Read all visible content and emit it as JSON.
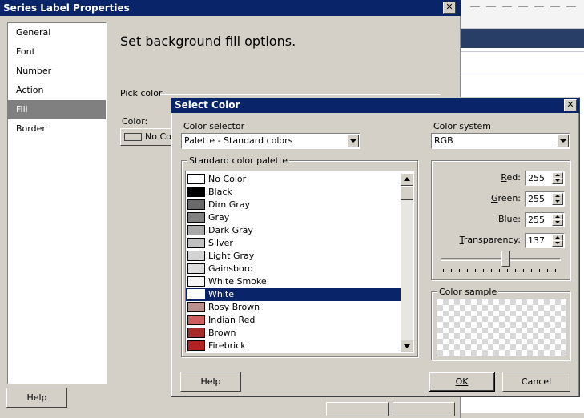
{
  "outer_window": {
    "title": "Series Label Properties",
    "close_glyph": "✕",
    "nav_items": [
      "General",
      "Font",
      "Number",
      "Action",
      "Fill",
      "Border"
    ],
    "nav_selected": "Fill",
    "heading": "Set background fill options.",
    "pick_color_label": "Pick color",
    "color_label": "Color:",
    "color_button_text": "No Co",
    "help_label": "Help"
  },
  "select_color_dialog": {
    "title": "Select Color",
    "close_glyph": "✕",
    "color_selector_label": "Color selector",
    "color_selector_value": "Palette - Standard colors",
    "color_system_label": "Color system",
    "color_system_value": "RGB",
    "palette_group_title": "Standard color palette",
    "palette_items": [
      {
        "name": "No Color",
        "color": "#ffffff"
      },
      {
        "name": "Black",
        "color": "#000000"
      },
      {
        "name": "Dim Gray",
        "color": "#696969"
      },
      {
        "name": "Gray",
        "color": "#808080"
      },
      {
        "name": "Dark Gray",
        "color": "#a9a9a9"
      },
      {
        "name": "Silver",
        "color": "#c0c0c0"
      },
      {
        "name": "Light Gray",
        "color": "#d3d3d3"
      },
      {
        "name": "Gainsboro",
        "color": "#dcdcdc"
      },
      {
        "name": "White Smoke",
        "color": "#f5f5f5"
      },
      {
        "name": "White",
        "color": "#ffffff"
      },
      {
        "name": "Rosy Brown",
        "color": "#bc8f8f"
      },
      {
        "name": "Indian Red",
        "color": "#cd5c5c"
      },
      {
        "name": "Brown",
        "color": "#a52a2a"
      },
      {
        "name": "Firebrick",
        "color": "#b22222"
      }
    ],
    "palette_selected": "White",
    "rgb": {
      "red_label": "Red:",
      "red_value": "255",
      "green_label": "Green:",
      "green_value": "255",
      "blue_label": "Blue:",
      "blue_value": "255",
      "transparency_label": "Transparency:",
      "transparency_value": "137"
    },
    "transparency_fraction": 0.537,
    "color_sample_title": "Color sample",
    "help_label": "Help",
    "ok_label": "OK",
    "cancel_label": "Cancel"
  },
  "colors": {
    "titlebar": "#0a246a",
    "selection": "#0a246a",
    "dialog_face": "#d4d0c8"
  }
}
